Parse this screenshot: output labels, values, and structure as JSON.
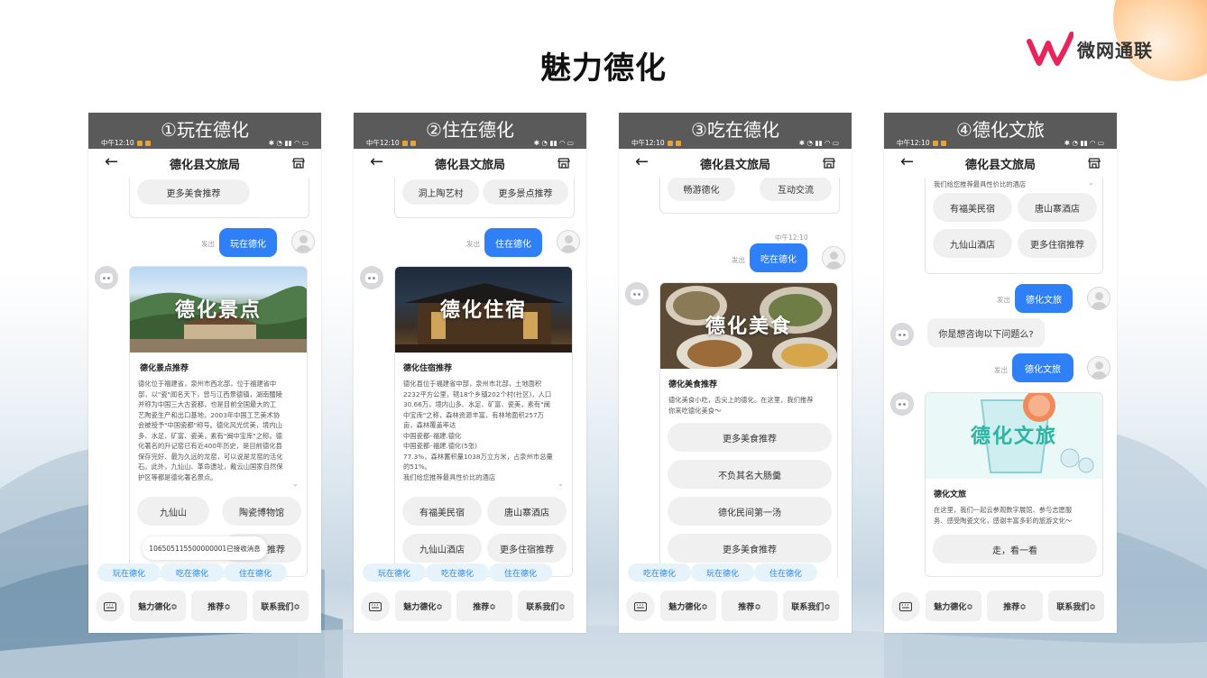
{
  "slide_title": "魅力德化",
  "brand": {
    "name": "微网通联",
    "accent": "#e8245a"
  },
  "colors": {
    "bubble": "#2f7ff6",
    "quick_text": "#2d87d7",
    "header_band": "#5a5a5a"
  },
  "common": {
    "status_time": "中午12:10",
    "nav_title": "德化县文旅局",
    "back_icon": "←",
    "sent": "发出",
    "bottom_menu": [
      "魅力德化≎",
      "推荐≎",
      "联系我们≎"
    ]
  },
  "phones": [
    {
      "label": "①玩在德化",
      "top_pills": [
        "更多美食推荐"
      ],
      "user_msg": "玩在德化",
      "card": {
        "hero_text": "德化景点",
        "title": "德化景点推荐",
        "desc": [
          "德化位于福建省，泉州市西北部，位于福建省中",
          "部，以\"瓷\"闻名天下，曾与江西景德镇，湖南醴陵",
          "并称为中国三大古瓷都，也是目前全国最大的工",
          "艺陶瓷生产和出口基地，2003年中国工艺美术协",
          "会被授予\"中国瓷都\"称号。德化风光优美，境内山",
          "多、水足、矿富、瓷美，素有\"闽中宝库\"之称。德",
          "化著名的升记窑已有近400年历史，是目前德化县",
          "保存完好、最为久远的龙窑，可以说是龙窑的活化",
          "石。此外，九仙山、革命遗址，戴云山国家自然保",
          "护区等都是德化著名景点。"
        ],
        "options": [
          "九仙山",
          "陶瓷博物馆",
          "",
          "推荐"
        ]
      },
      "toast": "106505115500000001已接收消息",
      "quick": [
        "玩在德化",
        "吃在德化",
        "住在德化"
      ]
    },
    {
      "label": "②住在德化",
      "top_pills": [
        "洞上陶艺村",
        "更多景点推荐"
      ],
      "user_msg": "住在德化",
      "card": {
        "hero_text": "德化住宿",
        "title": "德化住宿推荐",
        "desc": [
          "德化县位于福建省中部，泉州市北部，土地面积",
          "2232平方公里，辖18个乡镇202个村(社区)，人口",
          "30.66万，境内山多、水足、矿富、瓷美，素有\"闽",
          "中宝库\"之称，森林资源丰富，有林地面积257万",
          "亩，森林覆盖率达",
          "中国瓷都–福建.德化",
          "中国瓷都–福建.德化(5张)",
          "77.3%，森林蓄积量1038万立方米，占泉州市总量",
          "的51%。",
          "我们给您推荐最具性价比的酒店"
        ],
        "options": [
          "有福美民宿",
          "唐山寨酒店",
          "九仙山酒店",
          "更多住宿推荐"
        ]
      },
      "quick": [
        "玩在德化",
        "吃在德化",
        "住在德化"
      ]
    },
    {
      "label": "③吃在德化",
      "top_pills": [
        "畅游德化",
        "互动交流"
      ],
      "time": "中午12:10",
      "user_msg": "吃在德化",
      "card": {
        "hero_text": "德化美食",
        "title": "德化美食推荐",
        "desc": [
          "德化美食小吃，舌尖上的德化。在这里，我们推荐",
          "你来吃德化美食～"
        ],
        "options": [
          "更多美食推荐",
          "不负其名大肠羹",
          "德化民间第一汤",
          "更多美食推荐"
        ]
      },
      "quick": [
        "吃在德化",
        "玩在德化",
        "住在德化"
      ]
    },
    {
      "label": "④德化文旅",
      "top_text": "我们给您推荐最具性价比的酒店",
      "top_pills": [
        "有福美民宿",
        "唐山寨酒店",
        "九仙山酒店",
        "更多住宿推荐"
      ],
      "user_msg": "德化文旅",
      "bot_msg": "你是想咨询以下问题么?",
      "card": {
        "hero_text": "德化文旅",
        "title": "德化文旅",
        "desc": [
          "在这里，我们一起云参观数字展馆、参与志愿服",
          "务、感受陶瓷文化，感谢丰富多彩的旅游文化～"
        ],
        "options": [
          "走，看一看"
        ]
      }
    }
  ]
}
